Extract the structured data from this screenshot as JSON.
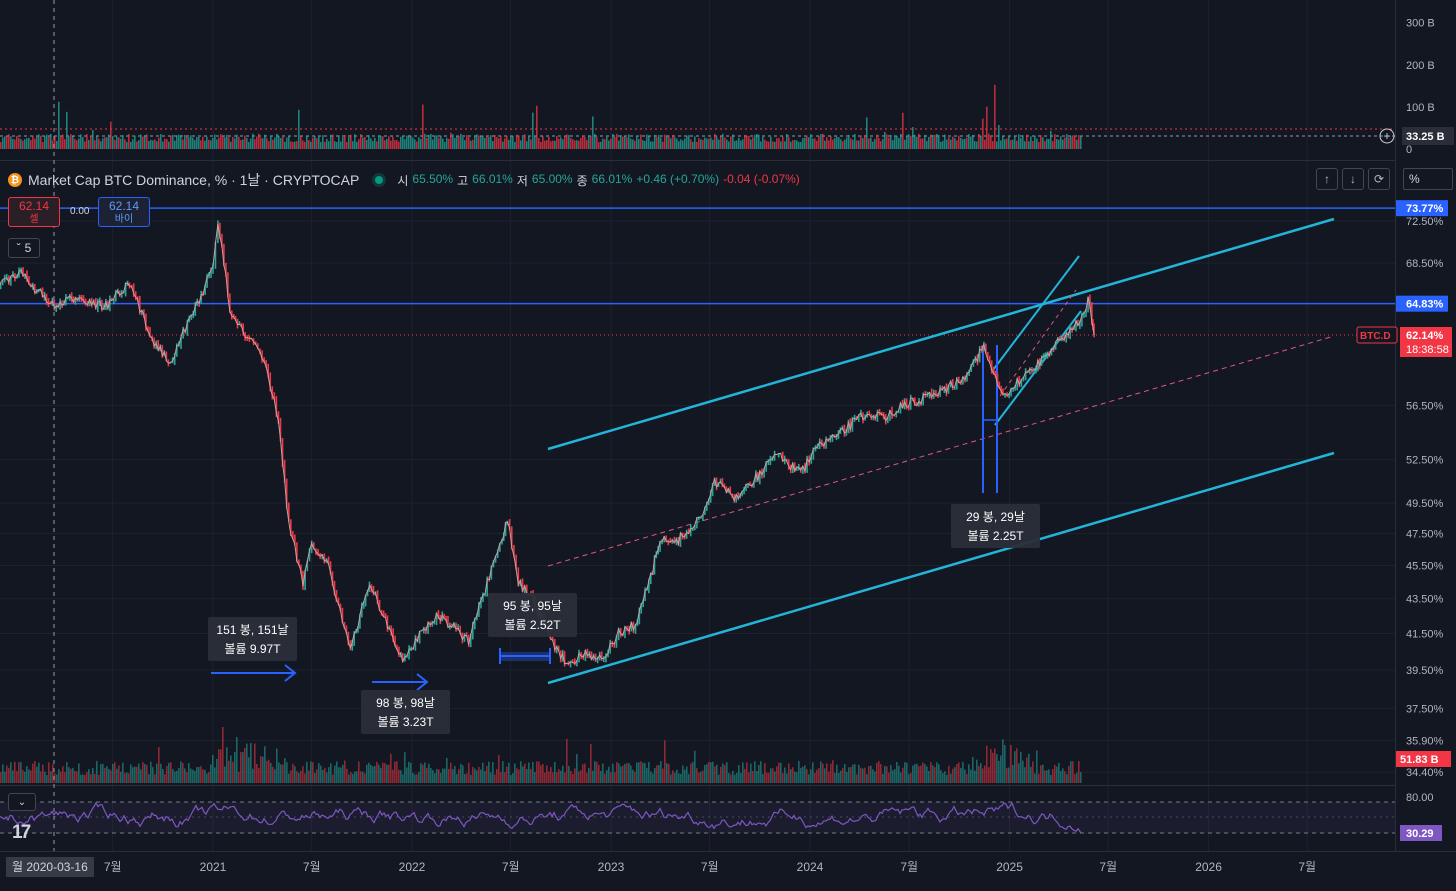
{
  "legend": {
    "icon_name": "bitcoin-icon",
    "title": "Market Cap BTC Dominance, % · 1날 · CRYPTOCAP",
    "open_label": "시",
    "open": "65.50%",
    "high_label": "고",
    "high": "66.01%",
    "low_label": "저",
    "low": "65.00%",
    "close_label": "종",
    "close": "66.01%",
    "change": "+0.46 (+0.70%)",
    "change2": "-0.04 (-0.07%)"
  },
  "trade": {
    "sell_value": "62.14",
    "sell_label": "셀",
    "spread": "0.00",
    "buy_value": "62.14",
    "buy_label": "바이"
  },
  "controls": {
    "collapse_count": "5",
    "scale_value": "%"
  },
  "colors": {
    "bg": "#131722",
    "up": "#26a69a",
    "down": "#f23645",
    "channel": "#22b5d8",
    "level": "#2962ff",
    "rsi": "#7e57c2"
  },
  "chart_data": [
    {
      "type": "bar",
      "name": "volume-top-pane",
      "y_ticks": [
        "300 B",
        "200 B",
        "100 B",
        "0"
      ],
      "ylim": [
        0,
        330
      ],
      "current_label": "33.25 B"
    },
    {
      "type": "line",
      "name": "btc-dominance-daily",
      "x_ticks": [
        "7월",
        "2021",
        "7월",
        "2022",
        "7월",
        "2023",
        "7월",
        "2024",
        "7월",
        "2025",
        "7월",
        "2026",
        "7월"
      ],
      "y_ticks": [
        "72.50%",
        "68.50%",
        "56.50%",
        "52.50%",
        "49.50%",
        "47.50%",
        "45.50%",
        "43.50%",
        "41.50%",
        "39.50%",
        "37.50%",
        "35.90%",
        "34.40%"
      ],
      "series": [
        {
          "x": [
            "2019-12-01",
            "2020-01-15",
            "2020-03-16",
            "2020-05-01",
            "2020-06-15",
            "2020-08-01",
            "2020-09-15",
            "2020-10-15",
            "2020-11-15",
            "2021-01-01",
            "2021-01-10",
            "2021-02-01",
            "2021-03-01",
            "2021-04-01",
            "2021-05-01",
            "2021-05-20",
            "2021-06-15",
            "2021-07-01",
            "2021-08-01",
            "2021-09-10",
            "2021-10-15",
            "2021-11-10",
            "2021-12-15",
            "2022-01-15",
            "2022-02-15",
            "2022-03-15",
            "2022-04-15",
            "2022-05-15",
            "2022-06-15",
            "2022-06-25",
            "2022-07-15",
            "2022-08-15",
            "2022-09-01",
            "2022-09-20",
            "2022-10-15",
            "2022-11-15",
            "2022-12-15",
            "2023-01-15",
            "2023-02-15",
            "2023-03-15",
            "2023-04-01",
            "2023-05-01",
            "2023-06-15",
            "2023-07-10",
            "2023-08-15",
            "2023-10-01",
            "2023-11-01",
            "2023-12-15",
            "2024-01-15",
            "2024-02-15",
            "2024-03-15",
            "2024-04-15",
            "2024-05-15",
            "2024-06-15",
            "2024-07-15",
            "2024-08-15",
            "2024-09-15",
            "2024-10-15",
            "2024-11-15",
            "2024-12-10",
            "2024-12-20",
            "2025-01-15",
            "2025-02-15",
            "2025-03-15",
            "2025-04-15",
            "2025-05-10",
            "2025-05-25",
            "2025-06-01",
            "2025-06-05"
          ],
          "y": [
            66.5,
            67.5,
            64.5,
            65.5,
            64.5,
            66.5,
            61.5,
            60.0,
            63.0,
            68.0,
            72.5,
            64.5,
            62.0,
            60.5,
            55.5,
            48.0,
            44.5,
            47.0,
            45.5,
            40.5,
            44.5,
            42.5,
            39.9,
            41.5,
            42.5,
            42.0,
            41.0,
            44.0,
            47.0,
            48.5,
            44.5,
            43.2,
            42.0,
            40.8,
            39.8,
            40.5,
            40.0,
            41.5,
            42.0,
            44.8,
            47.0,
            47.0,
            48.5,
            51.0,
            49.8,
            51.5,
            53.0,
            51.5,
            53.5,
            54.0,
            55.0,
            56.0,
            55.5,
            56.5,
            56.8,
            57.5,
            58.0,
            59.0,
            61.2,
            58.0,
            57.0,
            58.2,
            59.5,
            60.8,
            62.2,
            63.5,
            65.0,
            63.5,
            62.14
          ]
        }
      ],
      "levels": [
        {
          "value": 73.77,
          "label": "73.77%"
        },
        {
          "value": 64.83,
          "label": "64.83%"
        }
      ],
      "current": {
        "label": "BTC.D",
        "value": "62.14%",
        "countdown": "18:38:58"
      },
      "volume_label": "51.83 B",
      "annotations": [
        {
          "line1": "151 봉, 151날",
          "line2": "볼륨 9.97T"
        },
        {
          "line1": "98 봉, 98날",
          "line2": "볼륨 3.23T"
        },
        {
          "line1": "95 봉, 95날",
          "line2": "볼륨 2.52T"
        },
        {
          "line1": "29 봉, 29날",
          "line2": "볼륨 2.25T"
        }
      ],
      "crosshair_date": "월 2020-03-16"
    },
    {
      "type": "line",
      "name": "rsi-pane",
      "y_ticks": [
        "80.00"
      ],
      "current_label": "30.29"
    }
  ]
}
